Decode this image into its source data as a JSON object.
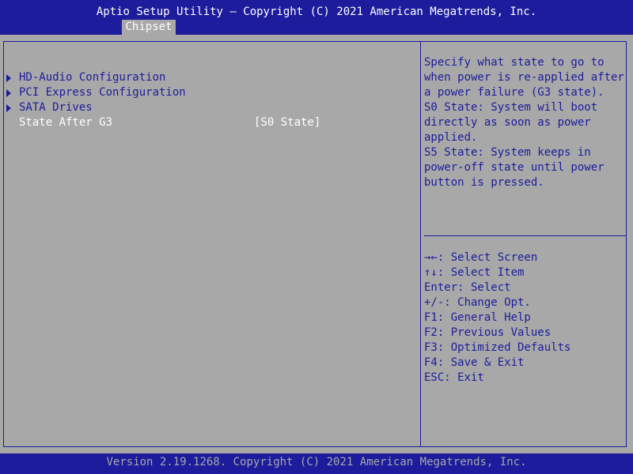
{
  "header": {
    "title": "Aptio Setup Utility – Copyright (C) 2021 American Megatrends, Inc.",
    "active_tab": "Chipset"
  },
  "menu": {
    "items": [
      {
        "label": "HD-Audio Configuration",
        "submenu": true
      },
      {
        "label": "PCI Express Configuration",
        "submenu": true
      },
      {
        "label": "SATA Drives",
        "submenu": true
      },
      {
        "label": "State After G3",
        "value": "[S0 State]",
        "submenu": false
      }
    ]
  },
  "help": {
    "lines": [
      "Specify what state to go to",
      "when power is re-applied after",
      "a power failure (G3 state).",
      "S0 State: System will boot",
      "directly as soon as power",
      "applied.",
      "S5 State: System keeps in",
      "power-off state until power",
      "button is pressed."
    ]
  },
  "keys": {
    "lines": [
      "→←: Select Screen",
      "↑↓: Select Item",
      "Enter: Select",
      "+/-: Change Opt.",
      "F1: General Help",
      "F2: Previous Values",
      "F3: Optimized Defaults",
      "F4: Save & Exit",
      "ESC: Exit"
    ]
  },
  "footer": {
    "text": "Version 2.19.1268. Copyright (C) 2021 American Megatrends, Inc."
  },
  "colors": {
    "blue": "#1c1c9c",
    "gray": "#a8a8a8",
    "white": "#ffffff"
  }
}
